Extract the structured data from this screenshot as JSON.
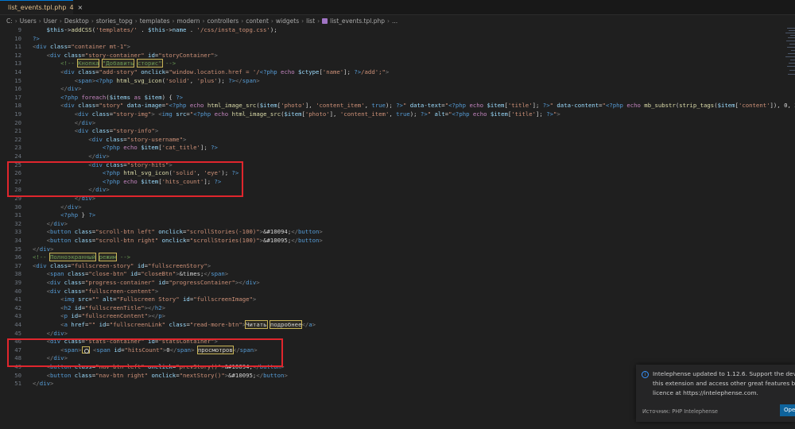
{
  "tab": {
    "filename": "list_events.tpl.php",
    "problems": "4",
    "close": "×"
  },
  "breadcrumb": [
    "C:",
    "Users",
    "User",
    "Desktop",
    "stories_topg",
    "templates",
    "modern",
    "controllers",
    "content",
    "widgets",
    "list",
    "list_events.tpl.php",
    "..."
  ],
  "lines": [
    {
      "n": "9",
      "html": "    <span class='v'>$this</span>-><span class='f'>addCSS</span>(<span class='s'>'templates/'</span> . <span class='v'>$this</span>-><span class='a'>name</span> . <span class='s'>'/css/insta_topg.css'</span>);"
    },
    {
      "n": "10",
      "html": "<span class='php'>?></span>"
    },
    {
      "n": "11",
      "html": "<span class='p'>&lt;</span><span class='k'>div</span> <span class='a'>class</span>=<span class='s'>\"container mt-1\"</span><span class='p'>&gt;</span>"
    },
    {
      "n": "12",
      "html": "    <span class='p'>&lt;</span><span class='k'>div</span> <span class='a'>class</span>=<span class='s'>\"story-container\"</span> <span class='a'>id</span>=<span class='s'>\"storyContainer\"</span><span class='p'>&gt;</span>"
    },
    {
      "n": "13",
      "html": "        <span class='c'>&lt;!-- <span class='hl'>Кнопка</span> <span class='hl'>\"Добавить</span> <span class='hl'>сторис\"</span> --&gt;</span>"
    },
    {
      "n": "14",
      "html": "        <span class='p'>&lt;</span><span class='k'>div</span> <span class='a'>class</span>=<span class='s'>\"add-story\"</span> <span class='a'>onclick</span>=<span class='s'>\"window.location.href = '/</span><span class='php'>&lt;?php</span> <span class='kw'>echo</span> <span class='v'>$ctype</span>[<span class='s'>'name'</span>]; <span class='php'>?&gt;</span><span class='s'>/add';\"</span><span class='p'>&gt;</span>"
    },
    {
      "n": "15",
      "html": "            <span class='p'>&lt;</span><span class='k'>span</span><span class='p'>&gt;</span><span class='php'>&lt;?php</span> <span class='f'>html_svg_icon</span>(<span class='s'>'solid'</span>, <span class='s'>'plus'</span>); <span class='php'>?&gt;</span><span class='p'>&lt;/</span><span class='k'>span</span><span class='p'>&gt;</span>"
    },
    {
      "n": "16",
      "html": "        <span class='p'>&lt;/</span><span class='k'>div</span><span class='p'>&gt;</span>"
    },
    {
      "n": "17",
      "html": "        <span class='php'>&lt;?php</span> <span class='kw'>foreach</span>(<span class='v'>$items</span> <span class='kw'>as</span> <span class='v'>$item</span>) { <span class='php'>?&gt;</span>"
    },
    {
      "n": "18",
      "html": "        <span class='p'>&lt;</span><span class='k'>div</span> <span class='a'>class</span>=<span class='s'>\"story\"</span> <span class='a'>data-image</span>=<span class='s'>\"</span><span class='php'>&lt;?php</span> <span class='kw'>echo</span> <span class='f'>html_image_src</span>(<span class='v'>$item</span>[<span class='s'>'photo'</span>], <span class='s'>'content_item'</span>, <span class='k'>true</span>); <span class='php'>?&gt;</span><span class='s'>\"</span> <span class='a'>data-text</span>=<span class='s'>\"</span><span class='php'>&lt;?php</span> <span class='kw'>echo</span> <span class='v'>$item</span>[<span class='s'>'title'</span>]; <span class='php'>?&gt;</span><span class='s'>\"</span> <span class='a'>data-content</span>=<span class='s'>\"</span><span class='php'>&lt;?php</span> <span class='kw'>echo</span> <span class='f'>mb_substr</span>(<span class='f'>strip_tags</span>(<span class='v'>$item</span>[<span class='s'>'content'</span>]), 0, 2"
    },
    {
      "n": "19",
      "html": "            <span class='p'>&lt;</span><span class='k'>div</span> <span class='a'>class</span>=<span class='s'>\"story-img\"</span><span class='p'>&gt;</span> <span class='p'>&lt;</span><span class='k'>img</span> <span class='a'>src</span>=<span class='s'>\"</span><span class='php'>&lt;?php</span> <span class='kw'>echo</span> <span class='f'>html_image_src</span>(<span class='v'>$item</span>[<span class='s'>'photo'</span>], <span class='s'>'content_item'</span>, <span class='k'>true</span>); <span class='php'>?&gt;</span><span class='s'>\"</span> <span class='a'>alt</span>=<span class='s'>\"</span><span class='php'>&lt;?php</span> <span class='kw'>echo</span> <span class='v'>$item</span>[<span class='s'>'title'</span>]; <span class='php'>?&gt;</span><span class='s'>\"</span><span class='p'>&gt;</span>"
    },
    {
      "n": "20",
      "html": "            <span class='p'>&lt;/</span><span class='k'>div</span><span class='p'>&gt;</span>"
    },
    {
      "n": "21",
      "html": "            <span class='p'>&lt;</span><span class='k'>div</span> <span class='a'>class</span>=<span class='s'>\"story-info\"</span><span class='p'>&gt;</span>"
    },
    {
      "n": "22",
      "html": "                <span class='p'>&lt;</span><span class='k'>div</span> <span class='a'>class</span>=<span class='s'>\"story-username\"</span><span class='p'>&gt;</span>"
    },
    {
      "n": "23",
      "html": "                    <span class='php'>&lt;?php</span> <span class='kw'>echo</span> <span class='v'>$item</span>[<span class='s'>'cat_title'</span>]; <span class='php'>?&gt;</span>"
    },
    {
      "n": "24",
      "html": "                <span class='p'>&lt;/</span><span class='k'>div</span><span class='p'>&gt;</span>"
    },
    {
      "n": "25",
      "html": "                <span class='p'>&lt;</span><span class='k'>div</span> <span class='a'>class</span>=<span class='s'>\"story-hits\"</span><span class='p'>&gt;</span>"
    },
    {
      "n": "26",
      "html": "                    <span class='php'>&lt;?php</span> <span class='f'>html_svg_icon</span>(<span class='s'>'solid'</span>, <span class='s'>'eye'</span>); <span class='php'>?&gt;</span>"
    },
    {
      "n": "27",
      "html": "                    <span class='php'>&lt;?php</span> <span class='kw'>echo</span> <span class='v'>$item</span>[<span class='s'>'hits_count'</span>]; <span class='php'>?&gt;</span>"
    },
    {
      "n": "28",
      "html": "                <span class='p'>&lt;/</span><span class='k'>div</span><span class='p'>&gt;</span>"
    },
    {
      "n": "29",
      "html": "            <span class='p'>&lt;/</span><span class='k'>div</span><span class='p'>&gt;</span>"
    },
    {
      "n": "30",
      "html": "        <span class='p'>&lt;/</span><span class='k'>div</span><span class='p'>&gt;</span>"
    },
    {
      "n": "31",
      "html": "        <span class='php'>&lt;?php</span> } <span class='php'>?&gt;</span>"
    },
    {
      "n": "32",
      "html": "    <span class='p'>&lt;/</span><span class='k'>div</span><span class='p'>&gt;</span>"
    },
    {
      "n": "33",
      "html": "    <span class='p'>&lt;</span><span class='k'>button</span> <span class='a'>class</span>=<span class='s'>\"scroll-btn left\"</span> <span class='a'>onclick</span>=<span class='s'>\"scrollStories(-100)\"</span><span class='p'>&gt;</span>&amp;#10094;<span class='p'>&lt;/</span><span class='k'>button</span><span class='p'>&gt;</span>"
    },
    {
      "n": "34",
      "html": "    <span class='p'>&lt;</span><span class='k'>button</span> <span class='a'>class</span>=<span class='s'>\"scroll-btn right\"</span> <span class='a'>onclick</span>=<span class='s'>\"scrollStories(100)\"</span><span class='p'>&gt;</span>&amp;#10095;<span class='p'>&lt;/</span><span class='k'>button</span><span class='p'>&gt;</span>"
    },
    {
      "n": "35",
      "html": "<span class='p'>&lt;/</span><span class='k'>div</span><span class='p'>&gt;</span>"
    },
    {
      "n": "36",
      "html": "<span class='c'>&lt;!-- <span class='hl'>Полноэкранный</span> <span class='hl'>режим</span> --&gt;</span>"
    },
    {
      "n": "37",
      "html": "<span class='p'>&lt;</span><span class='k'>div</span> <span class='a'>class</span>=<span class='s'>\"fullscreen-story\"</span> <span class='a'>id</span>=<span class='s'>\"fullscreenStory\"</span><span class='p'>&gt;</span>"
    },
    {
      "n": "38",
      "html": "    <span class='p'>&lt;</span><span class='k'>span</span> <span class='a'>class</span>=<span class='s'>\"close-btn\"</span> <span class='a'>id</span>=<span class='s'>\"closeBtn\"</span><span class='p'>&gt;</span>&amp;times;<span class='p'>&lt;/</span><span class='k'>span</span><span class='p'>&gt;</span>"
    },
    {
      "n": "39",
      "html": "    <span class='p'>&lt;</span><span class='k'>div</span> <span class='a'>class</span>=<span class='s'>\"progress-container\"</span> <span class='a'>id</span>=<span class='s'>\"progressContainer\"</span><span class='p'>&gt;&lt;/</span><span class='k'>div</span><span class='p'>&gt;</span>"
    },
    {
      "n": "40",
      "html": "    <span class='p'>&lt;</span><span class='k'>div</span> <span class='a'>class</span>=<span class='s'>\"fullscreen-content\"</span><span class='p'>&gt;</span>"
    },
    {
      "n": "41",
      "html": "        <span class='p'>&lt;</span><span class='k'>img</span> <span class='a'>src</span>=<span class='s'>\"\"</span> <span class='a'>alt</span>=<span class='s'>\"Fullscreen Story\"</span> <span class='a'>id</span>=<span class='s'>\"fullscreenImage\"</span><span class='p'>&gt;</span>"
    },
    {
      "n": "42",
      "html": "        <span class='p'>&lt;</span><span class='k'>h2</span> <span class='a'>id</span>=<span class='s'>\"fullscreenTitle\"</span><span class='p'>&gt;&lt;/</span><span class='k'>h2</span><span class='p'>&gt;</span>"
    },
    {
      "n": "43",
      "html": "        <span class='p'>&lt;</span><span class='k'>p</span> <span class='a'>id</span>=<span class='s'>\"fullscreenContent\"</span><span class='p'>&gt;&lt;/</span><span class='k'>p</span><span class='p'>&gt;</span>"
    },
    {
      "n": "44",
      "html": "        <span class='p'>&lt;</span><span class='k'>a</span> <span class='a'>href</span>=<span class='s'>\"\"</span> <span class='a'>id</span>=<span class='s'>\"fullscreenLink\"</span> <span class='a'>class</span>=<span class='s'>\"read-more-btn\"</span><span class='p'>&gt;</span><span class='hl'>Читать</span> <span class='hl'>подробнее</span><span class='p'>&lt;/</span><span class='k'>a</span><span class='p'>&gt;</span>"
    },
    {
      "n": "45",
      "html": "    <span class='p'>&lt;/</span><span class='k'>div</span><span class='p'>&gt;</span>"
    },
    {
      "n": "46",
      "html": "    <span class='p'>&lt;</span><span class='k'>div</span> <span class='a'>class</span>=<span class='s'>\"stats-container\"</span> <span class='a'>id</span>=<span class='s'>\"statsContainer\"</span><span class='p'>&gt;</span>"
    },
    {
      "n": "47",
      "html": "        <span class='p'>&lt;</span><span class='k'>span</span><span class='p'>&gt;</span><span class='eye-icon' data-name='eye-glyph-icon' data-interactable='false'></span> <span class='p'>&lt;</span><span class='k'>span</span> <span class='a'>id</span>=<span class='s'>\"hitsCount\"</span><span class='p'>&gt;</span>0<span class='p'>&lt;/</span><span class='k'>span</span><span class='p'>&gt;</span> <span class='hl'>просмотров</span><span class='p'>&lt;/</span><span class='k'>span</span><span class='p'>&gt;</span>"
    },
    {
      "n": "48",
      "html": "    <span class='p'>&lt;/</span><span class='k'>div</span><span class='p'>&gt;</span>"
    },
    {
      "n": "49",
      "html": "    <span class='p'>&lt;</span><span class='k'>button</span> <span class='a'>class</span>=<span class='s'>\"nav-btn left\"</span> <span class='a'>onclick</span>=<span class='s'>\"prevStory()\"</span><span class='p'>&gt;</span>&amp;#10094;<span class='p'>&lt;/</span><span class='k'>button</span><span class='p'>&gt;</span>"
    },
    {
      "n": "50",
      "html": "    <span class='p'>&lt;</span><span class='k'>button</span> <span class='a'>class</span>=<span class='s'>\"nav-btn right\"</span> <span class='a'>onclick</span>=<span class='s'>\"nextStory()\"</span><span class='p'>&gt;</span>&amp;#10095;<span class='p'>&lt;/</span><span class='k'>button</span><span class='p'>&gt;</span>"
    },
    {
      "n": "51",
      "html": "<span class='p'>&lt;/</span><span class='k'>div</span><span class='p'>&gt;</span>"
    }
  ],
  "notification": {
    "line1": "Intelephense updated to 1.12.6. Support the developme",
    "line2": "this extension and access other great features by purcha",
    "line3": "licence at https://intelephense.com.",
    "source": "Источник: PHP Intelephense",
    "button": "Ope"
  },
  "colors": {
    "accent": "#0078d4",
    "annotation": "#e0262d",
    "background": "#1f1f1f"
  }
}
